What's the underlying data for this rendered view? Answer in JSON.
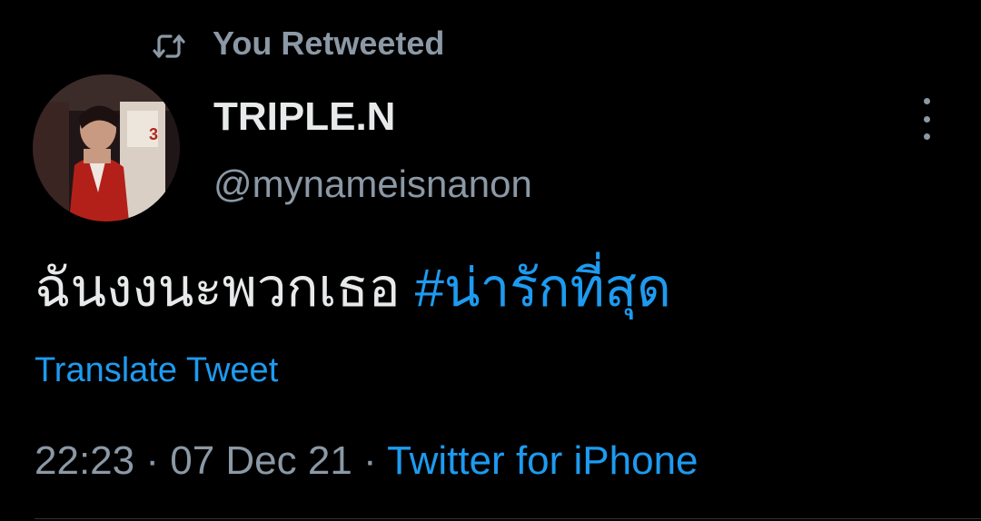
{
  "retweet": {
    "icon": "retweet-icon",
    "label": "You Retweeted"
  },
  "author": {
    "avatar": "profile-photo-avatar",
    "display_name": "TRIPLE.N",
    "handle": "@mynameisnanon"
  },
  "menu": {
    "icon": "more-vertical-icon"
  },
  "tweet": {
    "text": "ฉันงงนะพวกเธอ",
    "hashtag": "#น่ารักที่สุด",
    "translate_label": "Translate Tweet"
  },
  "meta": {
    "time": "22:23",
    "separator": "·",
    "date": "07 Dec 21",
    "source": "Twitter for iPhone"
  },
  "colors": {
    "background": "#000000",
    "primary_text": "#e7e9ea",
    "secondary_text": "#8b98a5",
    "link": "#1d9bf0"
  }
}
